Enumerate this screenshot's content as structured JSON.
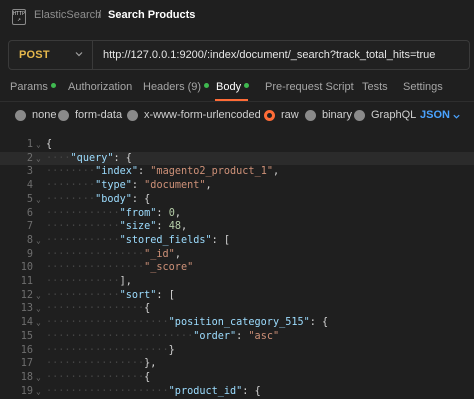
{
  "header": {
    "parent": "ElasticSearch",
    "separator": "/",
    "current": "Search Products",
    "icon_text_top": "HTTP",
    "icon_name": "http-request-icon"
  },
  "request": {
    "method": "POST",
    "method_color": "#e6b84c",
    "url": "http://127.0.0.1:9200/:index/document/_search?track_total_hits=true"
  },
  "tabs": [
    {
      "label": "Params",
      "dot": true
    },
    {
      "label": "Authorization",
      "dot": false
    },
    {
      "label": "Headers (9)",
      "dot": true
    },
    {
      "label": "Body",
      "dot": true,
      "active": true
    },
    {
      "label": "Pre-request Script",
      "dot": false
    },
    {
      "label": "Tests",
      "dot": false
    },
    {
      "label": "Settings",
      "dot": false
    }
  ],
  "accent_color": "#ff6c37",
  "body_options": [
    {
      "label": "none",
      "selected": false
    },
    {
      "label": "form-data",
      "selected": false
    },
    {
      "label": "x-www-form-urlencoded",
      "selected": false
    },
    {
      "label": "raw",
      "selected": true
    },
    {
      "label": "binary",
      "selected": false
    },
    {
      "label": "GraphQL",
      "selected": false
    }
  ],
  "format": "JSON",
  "editor": {
    "lines": [
      {
        "n": "1",
        "text": "{"
      },
      {
        "n": "2",
        "text": "    \"query\": {"
      },
      {
        "n": "3",
        "text": "        \"index\": \"magento2_product_1\","
      },
      {
        "n": "4",
        "text": "        \"type\": \"document\","
      },
      {
        "n": "5",
        "text": "        \"body\": {"
      },
      {
        "n": "6",
        "text": "            \"from\": 0,"
      },
      {
        "n": "7",
        "text": "            \"size\": 48,"
      },
      {
        "n": "8",
        "text": "            \"stored_fields\": ["
      },
      {
        "n": "9",
        "text": "                \"_id\","
      },
      {
        "n": "10",
        "text": "                \"_score\""
      },
      {
        "n": "11",
        "text": "            ],"
      },
      {
        "n": "12",
        "text": "            \"sort\": ["
      },
      {
        "n": "13",
        "text": "                {"
      },
      {
        "n": "14",
        "text": "                    \"position_category_515\": {"
      },
      {
        "n": "15",
        "text": "                        \"order\": \"asc\""
      },
      {
        "n": "16",
        "text": "                    }"
      },
      {
        "n": "17",
        "text": "                },"
      },
      {
        "n": "18",
        "text": "                {"
      },
      {
        "n": "19",
        "text": "                    \"product_id\": {"
      }
    ]
  }
}
